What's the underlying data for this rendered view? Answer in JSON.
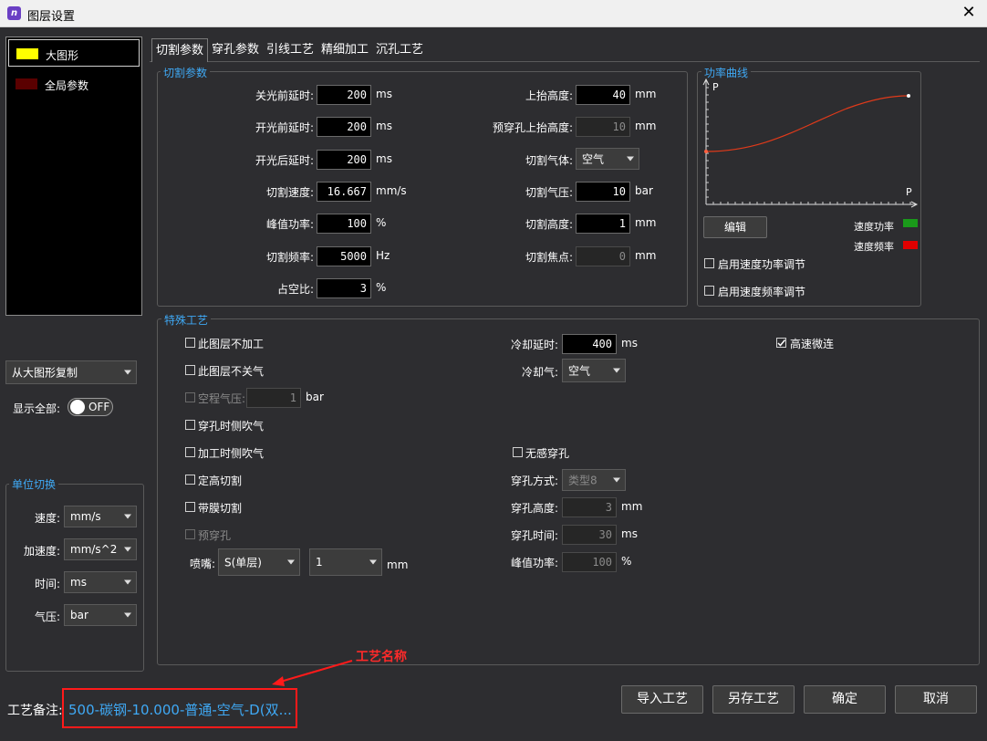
{
  "window": {
    "title": "图层设置",
    "icon_text": "n"
  },
  "left": {
    "layers": [
      {
        "label": "大图形",
        "color": "#ffff00",
        "selected": true
      },
      {
        "label": "全局参数",
        "color": "#5a0000",
        "selected": false
      }
    ],
    "copy_combo": "从大图形复制",
    "show_all_label": "显示全部:",
    "toggle_text": "OFF",
    "unit_group": {
      "title": "单位切换",
      "rows": [
        {
          "label": "速度:",
          "value": "mm/s"
        },
        {
          "label": "加速度:",
          "value": "mm/s^2"
        },
        {
          "label": "时间:",
          "value": "ms"
        },
        {
          "label": "气压:",
          "value": "bar"
        }
      ]
    }
  },
  "tabs": [
    "切割参数",
    "穿孔参数",
    "引线工艺",
    "精细加工",
    "沉孔工艺"
  ],
  "cut_params": {
    "title": "切割参数",
    "left_rows": [
      {
        "label": "关光前延时:",
        "value": "200",
        "unit": "ms"
      },
      {
        "label": "开光前延时:",
        "value": "200",
        "unit": "ms"
      },
      {
        "label": "开光后延时:",
        "value": "200",
        "unit": "ms"
      },
      {
        "label": "切割速度:",
        "value": "16.667",
        "unit": "mm/s"
      },
      {
        "label": "峰值功率:",
        "value": "100",
        "unit": "%"
      },
      {
        "label": "切割频率:",
        "value": "5000",
        "unit": "Hz"
      },
      {
        "label": "占空比:",
        "value": "3",
        "unit": "%"
      }
    ],
    "right_rows": [
      {
        "label": "上抬高度:",
        "value": "40",
        "unit": "mm",
        "disabled": false
      },
      {
        "label": "预穿孔上抬高度:",
        "value": "10",
        "unit": "mm",
        "disabled": true
      },
      {
        "label": "切割气体:",
        "value": "空气",
        "combo": true
      },
      {
        "label": "切割气压:",
        "value": "10",
        "unit": "bar",
        "disabled": false
      },
      {
        "label": "切割高度:",
        "value": "1",
        "unit": "mm",
        "disabled": false
      },
      {
        "label": "切割焦点:",
        "value": "0",
        "unit": "mm",
        "disabled": true
      }
    ]
  },
  "power_curve": {
    "title": "功率曲线",
    "axis_y": "P",
    "axis_x": "P",
    "edit_button": "编辑",
    "legend_speed_power": "速度功率",
    "legend_speed_freq": "速度频率",
    "speed_power_color": "#1a9a1a",
    "speed_freq_color": "#e00000",
    "check_power": "启用速度功率调节",
    "check_freq": "启用速度频率调节"
  },
  "special": {
    "title": "特殊工艺",
    "no_process": "此图层不加工",
    "no_gas_off": "此图层不关气",
    "idle_pressure_label": "空程气压:",
    "idle_pressure_value": "1",
    "idle_pressure_unit": "bar",
    "pierce_side_blow": "穿孔时侧吹气",
    "process_side_blow": "加工时侧吹气",
    "fixed_height_cut": "定高切割",
    "film_cut": "带膜切割",
    "pre_pierce": "预穿孔",
    "nozzle_label": "喷嘴:",
    "nozzle_type": "S(单层)",
    "nozzle_size": "1",
    "nozzle_unit": "mm",
    "cool_delay_label": "冷却延时:",
    "cool_delay_value": "400",
    "cool_delay_unit": "ms",
    "cool_gas_label": "冷却气:",
    "cool_gas_value": "空气",
    "hs_microjoint": "高速微连",
    "seamless_pierce": "无感穿孔",
    "pierce_mode_label": "穿孔方式:",
    "pierce_mode_value": "类型8",
    "pierce_height_label": "穿孔高度:",
    "pierce_height_value": "3",
    "pierce_height_unit": "mm",
    "pierce_time_label": "穿孔时间:",
    "pierce_time_value": "30",
    "pierce_time_unit": "ms",
    "peak_power_label": "峰值功率:",
    "peak_power_value": "100",
    "peak_power_unit": "%"
  },
  "footer": {
    "remark_label": "工艺备注:",
    "remark_value": "500-碳钢-10.000-普通-空气-D(双...",
    "annotation": "工艺名称",
    "import_button": "导入工艺",
    "saveas_button": "另存工艺",
    "ok_button": "确定",
    "cancel_button": "取消"
  }
}
